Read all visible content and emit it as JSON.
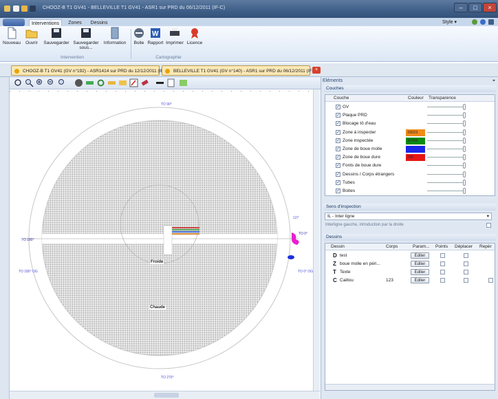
{
  "window": {
    "title": "CHOOZ-B T1 GV41 - BELLEVILLE T1 GV41 - ASR1 sur PRD du 06/12/2011 (IF-C)"
  },
  "ribbon_tabs": [
    "Interventions",
    "Zones",
    "Dessins"
  ],
  "style_menu": "Style",
  "ribbon": {
    "nouveau": "Nouveau",
    "ouvrir": "Ouvrir",
    "sauvegarder": "Sauvegarder",
    "sauvegarder_sous": "Sauvegarder sous...",
    "information": "Information",
    "boite": "Boite",
    "rapport": "Rapport",
    "imprimer": "Imprimer",
    "licence": "Licence",
    "group_intervention": "Intervention",
    "group_cartographie": "Cartographie"
  },
  "doc_tabs": [
    "CHOOZ-B T1 GV41 (GV n°192) - ASR1414 sur PRD du 12/12/2011 (IF-C)",
    "BELLEVILLE T1 GV41 (GV n°140) - ASR1 sur PRD du 06/12/2011 (IF-C)"
  ],
  "map": {
    "label_top": "TO 90°",
    "label_bottom": "TO 270°",
    "label_left": "TO 180°",
    "label_right": "TO 0°",
    "label_left_low": "TO 180° OG",
    "label_right_low": "TO 0° OG",
    "label_right_small": "127",
    "zone_froide": "Froide",
    "zone_chaude": "Chaude"
  },
  "panel": {
    "title": "Eléments",
    "couches_title": "Couches",
    "col_couche": "Couche",
    "col_couleur": "Couleur",
    "col_transparence": "Transparence",
    "layers": [
      {
        "name": "GV",
        "swatch": "",
        "color": ""
      },
      {
        "name": "Plaque PRD",
        "swatch": "",
        "color": ""
      },
      {
        "name": "Blocage tô d'eau",
        "swatch": "",
        "color": ""
      },
      {
        "name": "Zone à inspecter",
        "swatch": "33023",
        "color": "#f08a1a"
      },
      {
        "name": "Zone inspectée",
        "swatch": "32768",
        "color": "#0b8a10"
      },
      {
        "name": "Zone de boue molle",
        "swatch": "",
        "color": "#1b27e8"
      },
      {
        "name": "Zone de boue dure",
        "swatch": "255",
        "color": "#e81414"
      },
      {
        "name": "Fonts de boue dure",
        "swatch": "",
        "color": ""
      },
      {
        "name": "Dessins / Corps étrangers",
        "swatch": "",
        "color": ""
      },
      {
        "name": "Tubes",
        "swatch": "",
        "color": ""
      },
      {
        "name": "Boites",
        "swatch": "",
        "color": ""
      }
    ],
    "sens_title": "Sens d'inspection",
    "sens_value": "IL - Inter ligne",
    "sens_note": "Interligne gauche, introduction par la droite",
    "dessins_title": "Dessins",
    "dessins_cols": [
      "Dessin",
      "Corps",
      "Param...",
      "Points",
      "Déplacer",
      "Repèr"
    ],
    "dessins": [
      {
        "letter": "D",
        "name": "test",
        "corps": ""
      },
      {
        "letter": "Z",
        "name": "boue molle en péri...",
        "corps": ""
      },
      {
        "letter": "T",
        "name": "Texte",
        "corps": ""
      },
      {
        "letter": "C",
        "name": "Caillou",
        "corps": "123"
      }
    ],
    "edit_label": "Editer"
  },
  "colors": {
    "accent": "#3f5f88",
    "tube": "#b9b9b9",
    "magenta": "#e81ed2",
    "blue": "#1a2fe0"
  }
}
